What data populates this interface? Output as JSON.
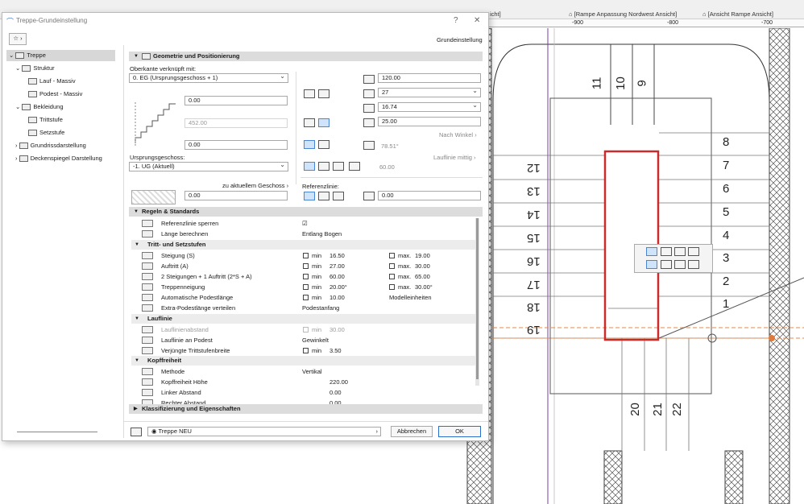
{
  "background": {
    "tabs": [
      "[Rampe Anpassung Nordwest Ansicht]",
      "[Ansicht Rampe Ansicht]",
      "icht]"
    ],
    "ruler": [
      "-900",
      "-800",
      "-700"
    ],
    "step_numbers_right": [
      "8",
      "7",
      "6",
      "5",
      "4",
      "3",
      "2",
      "1"
    ],
    "step_numbers_left": [
      "12",
      "13",
      "14",
      "15",
      "16",
      "17",
      "18",
      "19"
    ],
    "step_numbers_top": [
      "11",
      "10",
      "9"
    ],
    "step_numbers_bottom": [
      "20",
      "21",
      "22"
    ]
  },
  "dialog": {
    "title": "Treppe-Grundeinstellung",
    "help": "?",
    "close": "✕",
    "header_right": "Grundeinstellung",
    "tree": [
      {
        "label": "Treppe"
      },
      {
        "label": "Struktur"
      },
      {
        "label": "Lauf - Massiv"
      },
      {
        "label": "Podest - Massiv"
      },
      {
        "label": "Bekleidung"
      },
      {
        "label": "Trittstufe"
      },
      {
        "label": "Setzstufe"
      },
      {
        "label": "Grundrissdarstellung"
      },
      {
        "label": "Deckenspiegel Darstellung"
      }
    ],
    "geometry": {
      "section_title": "Geometrie und Positionierung",
      "oberkante_label": "Oberkante verknüpft mit:",
      "oberkante_value": "0. EG (Ursprungsgeschoss + 1)",
      "height_top": "0.00",
      "height_total": "452.00",
      "height_bottom": "0.00",
      "ursprung_label": "Ursprungsgeschoss:",
      "ursprung_value": "-1. UG (Aktuell)",
      "zu_aktuellem": "zu aktuellem Geschoss",
      "offset": "0.00",
      "width": "120.00",
      "risers": "27",
      "riser_height": "16.74",
      "tread": "25.00",
      "nach_winkel": "Nach Winkel",
      "angle": "78.51°",
      "lauflinie": "Lauflinie mittig",
      "lauflinie_val": "60.00",
      "referenzlinie_label": "Referenzlinie:",
      "ref_offset": "0.00"
    },
    "rules": {
      "section_title": "Regeln & Standards",
      "rows": [
        {
          "label": "Referenzlinie sperren",
          "value": "☑"
        },
        {
          "label": "Länge berechnen",
          "value": "Entlang Bogen"
        }
      ],
      "tritt_head": "Tritt- und Setzstufen",
      "tritt_rows": [
        {
          "label": "Steigung (S)",
          "min": "min",
          "minv": "16.50",
          "max": "max.",
          "maxv": "19.00"
        },
        {
          "label": "Auftritt (A)",
          "min": "min",
          "minv": "27.00",
          "max": "max.",
          "maxv": "30.00"
        },
        {
          "label": "2 Steigungen + 1 Auftritt (2*S + A)",
          "min": "min",
          "minv": "60.00",
          "max": "max.",
          "maxv": "65.00"
        },
        {
          "label": "Treppenneigung",
          "min": "min",
          "minv": "20.00°",
          "max": "max.",
          "maxv": "30.00°"
        },
        {
          "label": "Automatische Podestlänge",
          "min": "min",
          "minv": "10.00",
          "max": "",
          "maxv": "Modelleinheiten"
        },
        {
          "label": "Extra-Podestlänge verteilen",
          "min": "",
          "minv": "Podestanfang",
          "max": "",
          "maxv": ""
        }
      ],
      "lauf_head": "Lauflinie",
      "lauf_rows": [
        {
          "label": "Lauflinienabstand",
          "min": "min",
          "minv": "30.00"
        },
        {
          "label": "Lauflinie an Podest",
          "min": "",
          "minv": "Gewinkelt"
        },
        {
          "label": "Verjüngte Trittstufenbreite",
          "min": "min",
          "minv": "3.50"
        }
      ],
      "kopf_head": "Kopffreiheit",
      "kopf_rows": [
        {
          "label": "Methode",
          "value": "Vertikal"
        },
        {
          "label": "Kopffreiheit Höhe",
          "value": "220.00"
        },
        {
          "label": "Linker Abstand",
          "value": "0.00"
        },
        {
          "label": "Rechter Abstand",
          "value": "0.00"
        }
      ]
    },
    "klass_title": "Klassifizierung und Eigenschaften",
    "footer": {
      "layer": "Treppe NEU",
      "cancel": "Abbrechen",
      "ok": "OK"
    }
  }
}
